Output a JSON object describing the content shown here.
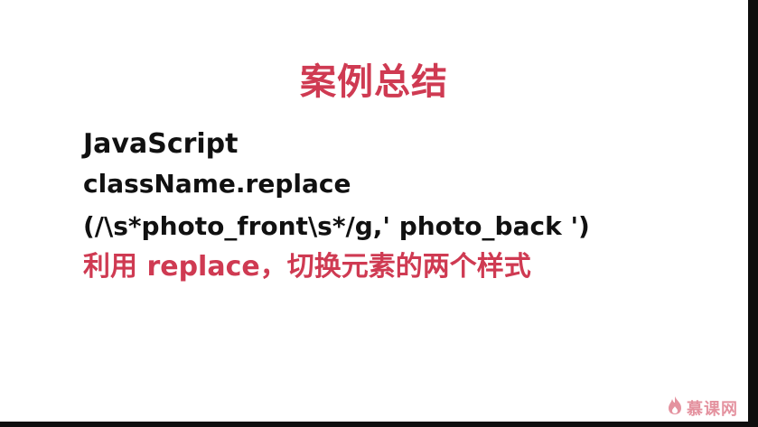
{
  "slide": {
    "title": "案例总结",
    "lines": [
      "JavaScript",
      "className.replace",
      "(/\\s*photo_front\\s*/g,' photo_back ')",
      "利用 replace，切换元素的两个样式"
    ],
    "watermark": "慕课网"
  },
  "colors": {
    "title": "#cf3a52",
    "text": "#111111",
    "highlight": "#cf3a52",
    "background": "#ffffff"
  },
  "icons": {
    "watermark": "flame-logo-icon"
  }
}
